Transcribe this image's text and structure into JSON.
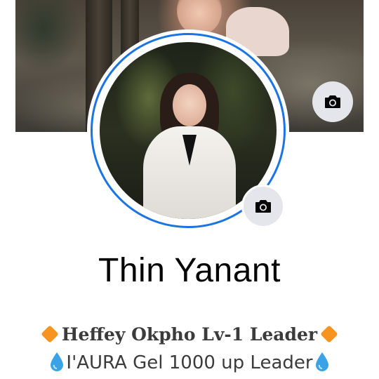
{
  "profile": {
    "name": "Thin Yanant",
    "bio_line_1": "Heffey Okpho Lv-1 Leader",
    "bio_line_2": "I'AURA Gel 1000 up Leader"
  },
  "icons": {
    "cover_camera": "camera-icon",
    "avatar_camera": "camera-icon",
    "bio_line_1_marker": "orange-diamond-emoji",
    "bio_line_2_marker": "droplet-emoji"
  },
  "colors": {
    "avatar_ring": "#1b74e4",
    "button_bg": "#e4e6eb",
    "diamond": "#f7931e",
    "droplet": "#3aa3e8"
  }
}
